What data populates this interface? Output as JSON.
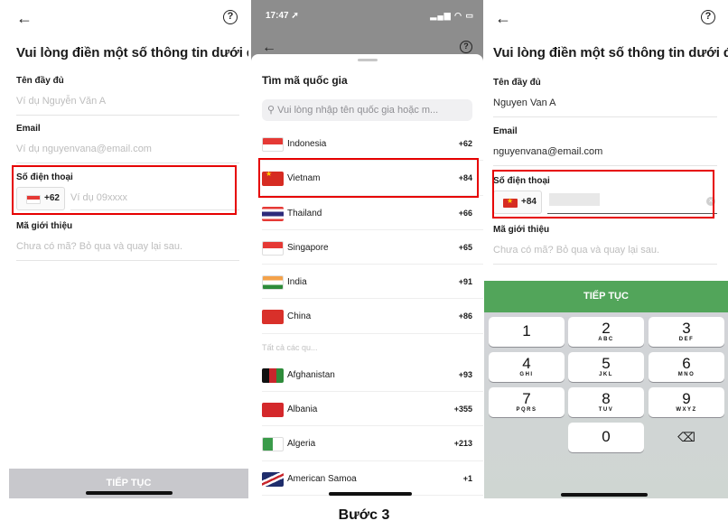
{
  "caption": "Bước 3",
  "screen1": {
    "back_icon": "←",
    "help_icon": "?",
    "title": "Vui lòng điền một số thông tin dưới đây",
    "full_name": {
      "label": "Tên đầy đủ",
      "placeholder": "Ví dụ Nguyễn Văn A"
    },
    "email": {
      "label": "Email",
      "placeholder": "Ví dụ nguyenvana@email.com"
    },
    "phone": {
      "label": "Số điện thoại",
      "country_code": "+62",
      "country_flag": "indonesia-flag",
      "placeholder": "Ví dụ 09xxxx"
    },
    "referral": {
      "label": "Mã giới thiệu",
      "placeholder": "Chưa có mã? Bỏ qua và quay lại sau."
    },
    "continue_button": "TIẾP TỤC",
    "continue_enabled": false
  },
  "screen2": {
    "status_time": "17:47 ➚",
    "status_icons": "▂▄▆ ◠ ▭",
    "back_icon": "←",
    "help_icon": "?",
    "sheet_title": "Tìm mã quốc gia",
    "search_icon": "⚲",
    "search_placeholder": "Vui lòng nhập tên quốc gia hoặc m...",
    "popular_countries": [
      {
        "name": "Indonesia",
        "code": "+62",
        "flag": "f-id"
      },
      {
        "name": "Vietnam",
        "code": "+84",
        "flag": "f-vn",
        "highlighted": true
      },
      {
        "name": "Thailand",
        "code": "+66",
        "flag": "f-thailand"
      },
      {
        "name": "Singapore",
        "code": "+65",
        "flag": "f-singapore"
      },
      {
        "name": "India",
        "code": "+91",
        "flag": "f-india"
      },
      {
        "name": "China",
        "code": "+86",
        "flag": "f-china"
      }
    ],
    "all_countries_label": "Tất cả các qu...",
    "all_countries": [
      {
        "name": "Afghanistan",
        "code": "+93",
        "flag": "f-afghanistan"
      },
      {
        "name": "Albania",
        "code": "+355",
        "flag": "f-albania"
      },
      {
        "name": "Algeria",
        "code": "+213",
        "flag": "f-algeria"
      },
      {
        "name": "American Samoa",
        "code": "+1",
        "flag": "f-samoa"
      }
    ]
  },
  "screen3": {
    "back_icon": "←",
    "help_icon": "?",
    "title": "Vui lòng điền một số thông tin dưới đây",
    "full_name": {
      "label": "Tên đầy đủ",
      "value": "Nguyen Van A"
    },
    "email": {
      "label": "Email",
      "value": "nguyenvana@email.com"
    },
    "phone": {
      "label": "Số điện thoại",
      "country_code": "+84",
      "country_flag": "vietnam-flag",
      "value_masked": true,
      "clear_icon": "×"
    },
    "referral": {
      "label": "Mã giới thiệu",
      "placeholder": "Chưa có mã? Bỏ qua và quay lại sau."
    },
    "continue_button": "TIẾP TỤC",
    "continue_enabled": true,
    "accent_color": "#52a55a",
    "keypad": [
      {
        "digit": "1",
        "letters": ""
      },
      {
        "digit": "2",
        "letters": "ABC"
      },
      {
        "digit": "3",
        "letters": "DEF"
      },
      {
        "digit": "4",
        "letters": "GHI"
      },
      {
        "digit": "5",
        "letters": "JKL"
      },
      {
        "digit": "6",
        "letters": "MNO"
      },
      {
        "digit": "7",
        "letters": "PQRS"
      },
      {
        "digit": "8",
        "letters": "TUV"
      },
      {
        "digit": "9",
        "letters": "WXYZ"
      },
      {
        "digit": "0",
        "letters": ""
      }
    ],
    "delete_icon": "⌫"
  }
}
